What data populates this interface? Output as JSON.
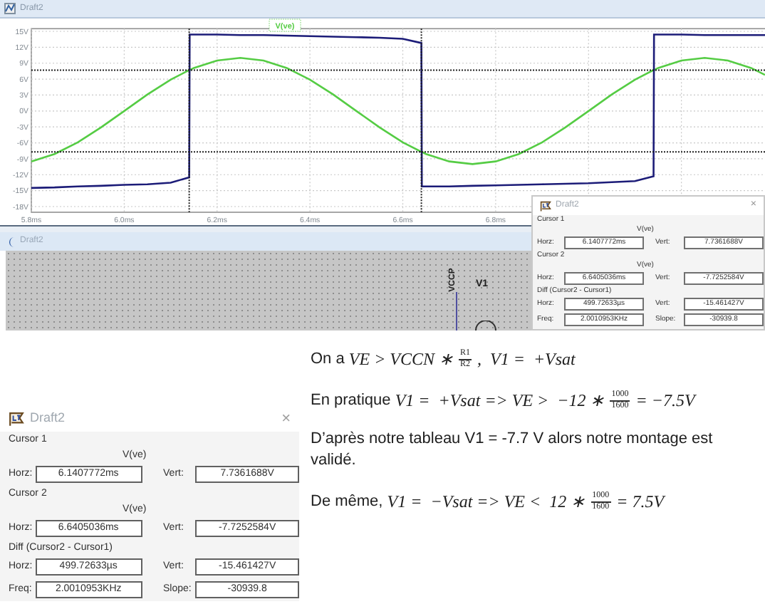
{
  "waveform_window": {
    "title": "Draft2",
    "chart_data": {
      "type": "line",
      "x": [
        5.8,
        5.85,
        5.9,
        5.95,
        6.0,
        6.05,
        6.1,
        6.14,
        6.141,
        6.15,
        6.2,
        6.25,
        6.3,
        6.35,
        6.4,
        6.45,
        6.5,
        6.55,
        6.6,
        6.64,
        6.641,
        6.65,
        6.7,
        6.75,
        6.8,
        6.85,
        6.9,
        6.95,
        7.0,
        7.05,
        7.1,
        7.14,
        7.141,
        7.15,
        7.2,
        7.25,
        7.3,
        7.35,
        7.38
      ],
      "series": [
        {
          "name": "V(ve)",
          "color": "#55cc44",
          "values": [
            -9.5,
            -8.1,
            -5.9,
            -3.1,
            0,
            3.1,
            5.9,
            7.7,
            7.7,
            8.1,
            9.5,
            10,
            9.5,
            8.1,
            5.9,
            3.1,
            0,
            -3.1,
            -5.9,
            -7.7,
            -7.7,
            -8.1,
            -9.5,
            -10,
            -9.5,
            -8.1,
            -5.9,
            -3.1,
            0,
            3.1,
            5.9,
            7.7,
            7.7,
            8.1,
            9.5,
            10,
            9.5,
            8.1,
            6.8
          ]
        },
        {
          "color": "#1c1c78",
          "values": [
            -14.5,
            -14.4,
            -14.2,
            -14.1,
            -13.9,
            -13.8,
            -13.5,
            -12.5,
            14.4,
            14.4,
            14.4,
            14.3,
            14.3,
            14.2,
            14.1,
            14.0,
            13.9,
            13.8,
            13.6,
            12.8,
            -14.2,
            -14.2,
            -14.2,
            -14.1,
            -14.0,
            -13.9,
            -13.8,
            -13.7,
            -13.6,
            -13.4,
            -13.2,
            -12.3,
            14.4,
            14.4,
            14.4,
            14.3,
            14.3,
            14.3,
            14.3
          ]
        }
      ],
      "xlim": [
        5.8,
        7.38
      ],
      "ylim": [
        -18,
        15.5
      ],
      "xticks": [
        {
          "value": 5.8,
          "label": "5.8ms"
        },
        {
          "value": 6.0,
          "label": "6.0ms"
        },
        {
          "value": 6.2,
          "label": "6.2ms"
        },
        {
          "value": 6.4,
          "label": "6.4ms"
        },
        {
          "value": 6.6,
          "label": "6.6ms"
        },
        {
          "value": 6.8,
          "label": "6.8ms"
        }
      ],
      "yticks": [
        {
          "value": 15,
          "label": "15V"
        },
        {
          "value": 12,
          "label": "12V"
        },
        {
          "value": 9,
          "label": "9V"
        },
        {
          "value": 6,
          "label": "6V"
        },
        {
          "value": 3,
          "label": "3V"
        },
        {
          "value": 0,
          "label": "0V"
        },
        {
          "value": -3,
          "label": "-3V"
        },
        {
          "value": -6,
          "label": "-6V"
        },
        {
          "value": -9,
          "label": "-9V"
        },
        {
          "value": -12,
          "label": "-12V"
        },
        {
          "value": -15,
          "label": "-15V"
        },
        {
          "value": -18,
          "label": "-18V"
        }
      ],
      "grid": true,
      "ref_lines": [
        {
          "axis": "x",
          "value": 6.14
        },
        {
          "axis": "x",
          "value": 6.64
        },
        {
          "axis": "y",
          "value": 7.7
        },
        {
          "axis": "y",
          "value": -7.7
        }
      ]
    }
  },
  "schematic_window": {
    "title": "Draft2",
    "labels": [
      {
        "kind": "net",
        "text": "VCCP"
      },
      {
        "kind": "part",
        "text": "V1"
      }
    ]
  },
  "cursor_dialogs": [
    {
      "title": "Draft2",
      "close": "×",
      "sections": [
        {
          "heading": "Cursor 1",
          "trace": "V(ve)",
          "rows": [
            {
              "label_1": "Horz:",
              "value_1": "6.1407772ms",
              "label_2": "Vert:",
              "value_2": "7.7361688V"
            }
          ]
        },
        {
          "heading": "Cursor 2",
          "trace": "V(ve)",
          "rows": [
            {
              "label_1": "Horz:",
              "value_1": "6.6405036ms",
              "label_2": "Vert:",
              "value_2": "-7.7252584V"
            }
          ]
        },
        {
          "heading": "Diff (Cursor2 - Cursor1)",
          "rows": [
            {
              "label_1": "Horz:",
              "value_1": "499.72633µs",
              "label_2": "Vert:",
              "value_2": "-15.461427V"
            },
            {
              "label_1": "Freq:",
              "value_1": "2.0010953KHz",
              "label_2": "Slope:",
              "value_2": "-30939.8"
            }
          ]
        }
      ]
    },
    {
      "title": "Draft2",
      "close": "×",
      "sections": [
        {
          "heading": "Cursor 1",
          "trace": "V(ve)",
          "rows": [
            {
              "label_1": "Horz:",
              "value_1": "6.1407772ms",
              "label_2": "Vert:",
              "value_2": "7.7361688V"
            }
          ]
        },
        {
          "heading": "Cursor 2",
          "trace": "V(ve)",
          "rows": [
            {
              "label_1": "Horz:",
              "value_1": "6.6405036ms",
              "label_2": "Vert:",
              "value_2": "-7.7252584V"
            }
          ]
        },
        {
          "heading": "Diff (Cursor2 - Cursor1)",
          "rows": [
            {
              "label_1": "Horz:",
              "value_1": "499.72633µs",
              "label_2": "Vert:",
              "value_2": "-15.461427V"
            },
            {
              "label_1": "Freq:",
              "value_1": "2.0010953KHz",
              "label_2": "Slope:",
              "value_2": "-30939.8"
            }
          ]
        }
      ]
    }
  ],
  "explanation": [
    [
      {
        "kind": "text",
        "text": "On a "
      },
      {
        "kind": "math",
        "text": "VE > VCCN ∗ "
      },
      {
        "kind": "frac",
        "num": "R1",
        "den": "R2"
      },
      {
        "kind": "math",
        "text": " ,  V1 =  +Vsat"
      }
    ],
    [
      {
        "kind": "text",
        "text": "En pratique "
      },
      {
        "kind": "math",
        "text": "V1 =  +Vsat => VE >  −12 ∗ "
      },
      {
        "kind": "frac",
        "num": "1000",
        "den": "1600"
      },
      {
        "kind": "math",
        "text": " = −7.5V"
      }
    ],
    [
      {
        "kind": "text",
        "text": "D’après notre tableau V1 = -7.7 V alors notre montage est validé."
      }
    ],
    [
      {
        "kind": "text",
        "text": "De même, "
      },
      {
        "kind": "math",
        "text": "V1 =  −Vsat => VE <  12 ∗ "
      },
      {
        "kind": "frac",
        "num": "1000",
        "den": "1600"
      },
      {
        "kind": "math",
        "text": " = 7.5V"
      }
    ]
  ]
}
